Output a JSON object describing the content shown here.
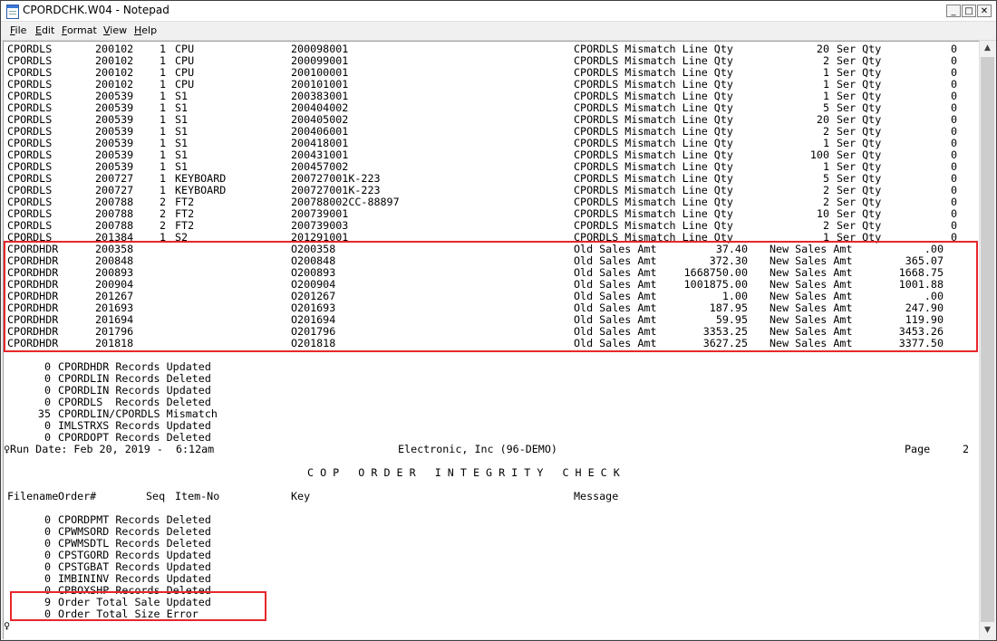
{
  "window": {
    "title": "CPORDCHK.W04 - Notepad",
    "minimize": "_",
    "maximize": "□",
    "close": "✕"
  },
  "menu": [
    {
      "label": "File",
      "accel": "F",
      "rest": "ile"
    },
    {
      "label": "Edit",
      "accel": "E",
      "rest": "dit"
    },
    {
      "label": "Format",
      "accel": "F",
      "rest": "ormat"
    },
    {
      "label": "View",
      "accel": "V",
      "rest": "iew"
    },
    {
      "label": "Help",
      "accel": "H",
      "rest": "elp"
    }
  ],
  "mismatch_rows": [
    {
      "file": "CPORDLS",
      "order": "200102",
      "seq": "1",
      "item": "CPU",
      "key": "200098001",
      "msg": "CPORDLS Mismatch Line Qty",
      "line_qty": "20",
      "ser_label": "Ser Qty",
      "ser_qty": "0"
    },
    {
      "file": "CPORDLS",
      "order": "200102",
      "seq": "1",
      "item": "CPU",
      "key": "200099001",
      "msg": "CPORDLS Mismatch Line Qty",
      "line_qty": "2",
      "ser_label": "Ser Qty",
      "ser_qty": "0"
    },
    {
      "file": "CPORDLS",
      "order": "200102",
      "seq": "1",
      "item": "CPU",
      "key": "200100001",
      "msg": "CPORDLS Mismatch Line Qty",
      "line_qty": "1",
      "ser_label": "Ser Qty",
      "ser_qty": "0"
    },
    {
      "file": "CPORDLS",
      "order": "200102",
      "seq": "1",
      "item": "CPU",
      "key": "200101001",
      "msg": "CPORDLS Mismatch Line Qty",
      "line_qty": "1",
      "ser_label": "Ser Qty",
      "ser_qty": "0"
    },
    {
      "file": "CPORDLS",
      "order": "200539",
      "seq": "1",
      "item": "S1",
      "key": "200383001",
      "msg": "CPORDLS Mismatch Line Qty",
      "line_qty": "1",
      "ser_label": "Ser Qty",
      "ser_qty": "0"
    },
    {
      "file": "CPORDLS",
      "order": "200539",
      "seq": "1",
      "item": "S1",
      "key": "200404002",
      "msg": "CPORDLS Mismatch Line Qty",
      "line_qty": "5",
      "ser_label": "Ser Qty",
      "ser_qty": "0"
    },
    {
      "file": "CPORDLS",
      "order": "200539",
      "seq": "1",
      "item": "S1",
      "key": "200405002",
      "msg": "CPORDLS Mismatch Line Qty",
      "line_qty": "20",
      "ser_label": "Ser Qty",
      "ser_qty": "0"
    },
    {
      "file": "CPORDLS",
      "order": "200539",
      "seq": "1",
      "item": "S1",
      "key": "200406001",
      "msg": "CPORDLS Mismatch Line Qty",
      "line_qty": "2",
      "ser_label": "Ser Qty",
      "ser_qty": "0"
    },
    {
      "file": "CPORDLS",
      "order": "200539",
      "seq": "1",
      "item": "S1",
      "key": "200418001",
      "msg": "CPORDLS Mismatch Line Qty",
      "line_qty": "1",
      "ser_label": "Ser Qty",
      "ser_qty": "0"
    },
    {
      "file": "CPORDLS",
      "order": "200539",
      "seq": "1",
      "item": "S1",
      "key": "200431001",
      "msg": "CPORDLS Mismatch Line Qty",
      "line_qty": "100",
      "ser_label": "Ser Qty",
      "ser_qty": "0"
    },
    {
      "file": "CPORDLS",
      "order": "200539",
      "seq": "1",
      "item": "S1",
      "key": "200457002",
      "msg": "CPORDLS Mismatch Line Qty",
      "line_qty": "1",
      "ser_label": "Ser Qty",
      "ser_qty": "0"
    },
    {
      "file": "CPORDLS",
      "order": "200727",
      "seq": "1",
      "item": "KEYBOARD",
      "key": "200727001K-223",
      "msg": "CPORDLS Mismatch Line Qty",
      "line_qty": "5",
      "ser_label": "Ser Qty",
      "ser_qty": "0"
    },
    {
      "file": "CPORDLS",
      "order": "200727",
      "seq": "1",
      "item": "KEYBOARD",
      "key": "200727001K-223",
      "msg": "CPORDLS Mismatch Line Qty",
      "line_qty": "2",
      "ser_label": "Ser Qty",
      "ser_qty": "0"
    },
    {
      "file": "CPORDLS",
      "order": "200788",
      "seq": "2",
      "item": "FT2",
      "key": "200788002CC-88897",
      "msg": "CPORDLS Mismatch Line Qty",
      "line_qty": "2",
      "ser_label": "Ser Qty",
      "ser_qty": "0"
    },
    {
      "file": "CPORDLS",
      "order": "200788",
      "seq": "2",
      "item": "FT2",
      "key": "200739001",
      "msg": "CPORDLS Mismatch Line Qty",
      "line_qty": "10",
      "ser_label": "Ser Qty",
      "ser_qty": "0"
    },
    {
      "file": "CPORDLS",
      "order": "200788",
      "seq": "2",
      "item": "FT2",
      "key": "200739003",
      "msg": "CPORDLS Mismatch Line Qty",
      "line_qty": "2",
      "ser_label": "Ser Qty",
      "ser_qty": "0"
    },
    {
      "file": "CPORDLS",
      "order": "201384",
      "seq": "1",
      "item": "S2",
      "key": "201291001",
      "msg": "CPORDLS Mismatch Line Qty",
      "line_qty": "1",
      "ser_label": "Ser Qty",
      "ser_qty": "0"
    }
  ],
  "header_rows": [
    {
      "file": "CPORDHDR",
      "order": "200358",
      "key": "O200358",
      "old_label": "Old Sales Amt",
      "old_amt": "37.40",
      "new_label": "New Sales Amt",
      "new_amt": ".00"
    },
    {
      "file": "CPORDHDR",
      "order": "200848",
      "key": "O200848",
      "old_label": "Old Sales Amt",
      "old_amt": "372.30",
      "new_label": "New Sales Amt",
      "new_amt": "365.07"
    },
    {
      "file": "CPORDHDR",
      "order": "200893",
      "key": "O200893",
      "old_label": "Old Sales Amt",
      "old_amt": "1668750.00",
      "new_label": "New Sales Amt",
      "new_amt": "1668.75"
    },
    {
      "file": "CPORDHDR",
      "order": "200904",
      "key": "O200904",
      "old_label": "Old Sales Amt",
      "old_amt": "1001875.00",
      "new_label": "New Sales Amt",
      "new_amt": "1001.88"
    },
    {
      "file": "CPORDHDR",
      "order": "201267",
      "key": "O201267",
      "old_label": "Old Sales Amt",
      "old_amt": "1.00",
      "new_label": "New Sales Amt",
      "new_amt": ".00"
    },
    {
      "file": "CPORDHDR",
      "order": "201693",
      "key": "O201693",
      "old_label": "Old Sales Amt",
      "old_amt": "187.95",
      "new_label": "New Sales Amt",
      "new_amt": "247.90"
    },
    {
      "file": "CPORDHDR",
      "order": "201694",
      "key": "O201694",
      "old_label": "Old Sales Amt",
      "old_amt": "59.95",
      "new_label": "New Sales Amt",
      "new_amt": "119.90"
    },
    {
      "file": "CPORDHDR",
      "order": "201796",
      "key": "O201796",
      "old_label": "Old Sales Amt",
      "old_amt": "3353.25",
      "new_label": "New Sales Amt",
      "new_amt": "3453.26"
    },
    {
      "file": "CPORDHDR",
      "order": "201818",
      "key": "O201818",
      "old_label": "Old Sales Amt",
      "old_amt": "3627.25",
      "new_label": "New Sales Amt",
      "new_amt": "3377.50"
    }
  ],
  "summary1": [
    {
      "count": "0",
      "text": "CPORDHDR Records Updated"
    },
    {
      "count": "0",
      "text": "CPORDLIN Records Deleted"
    },
    {
      "count": "0",
      "text": "CPORDLIN Records Updated"
    },
    {
      "count": "0",
      "text": "CPORDLS  Records Deleted"
    },
    {
      "count": "35",
      "text": "CPORDLIN/CPORDLS Mismatch"
    },
    {
      "count": "0",
      "text": "IMLSTRXS Records Updated"
    },
    {
      "count": "0",
      "text": "CPORDOPT Records Deleted"
    }
  ],
  "page_header": {
    "run_date": "♀Run Date: Feb 20, 2019 -  6:12am",
    "company": "Electronic, Inc (96-DEMO)",
    "page_label": "Page",
    "page_num": "2",
    "report_title": "C O P   O R D E R   I N T E G R I T Y   C H E C K",
    "columns": {
      "filename": "Filename",
      "order": "Order#",
      "seq": "Seq",
      "item": "Item-No",
      "key": "Key",
      "message": "Message"
    }
  },
  "summary2": [
    {
      "count": "0",
      "text": "CPORDPMT Records Deleted"
    },
    {
      "count": "0",
      "text": "CPWMSORD Records Deleted"
    },
    {
      "count": "0",
      "text": "CPWMSDTL Records Deleted"
    },
    {
      "count": "0",
      "text": "CPSTGORD Records Updated"
    },
    {
      "count": "0",
      "text": "CPSTGBAT Records Updated"
    },
    {
      "count": "0",
      "text": "IMBININV Records Updated"
    },
    {
      "count": "0",
      "text": "CPBOXSHP Records Deleted"
    },
    {
      "count": "9",
      "text": "Order Total Sale Updated"
    },
    {
      "count": "0",
      "text": "Order Total Size Error"
    }
  ],
  "last_line": "♀",
  "colors": {
    "highlight": "#e8262b",
    "text": "#000000",
    "background": "#ffffff"
  }
}
